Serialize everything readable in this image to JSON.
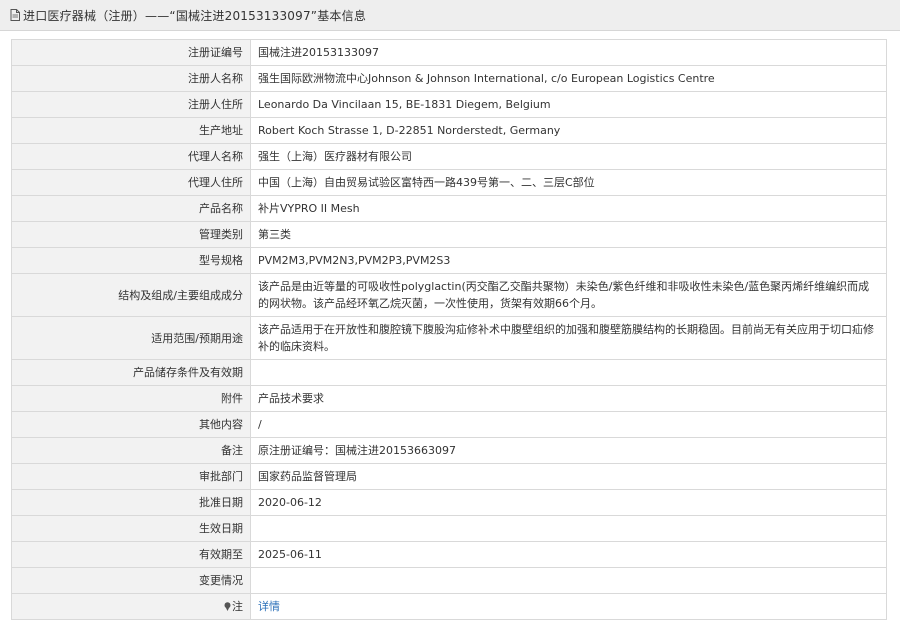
{
  "header": {
    "title": "进口医疗器械（注册）——“国械注进20153133097”基本信息"
  },
  "rows": [
    {
      "label": "注册证编号",
      "value": "国械注进20153133097"
    },
    {
      "label": "注册人名称",
      "value": "强生国际欧洲物流中心Johnson & Johnson International, c/o European Logistics Centre"
    },
    {
      "label": "注册人住所",
      "value": "Leonardo Da Vincilaan 15, BE-1831 Diegem, Belgium"
    },
    {
      "label": "生产地址",
      "value": "Robert Koch Strasse 1, D-22851 Norderstedt, Germany"
    },
    {
      "label": "代理人名称",
      "value": "强生（上海）医疗器材有限公司"
    },
    {
      "label": "代理人住所",
      "value": "中国（上海）自由贸易试验区富特西一路439号第一、二、三层C部位"
    },
    {
      "label": "产品名称",
      "value": "补片VYPRO II Mesh"
    },
    {
      "label": "管理类别",
      "value": "第三类"
    },
    {
      "label": "型号规格",
      "value": "PVM2M3,PVM2N3,PVM2P3,PVM2S3"
    },
    {
      "label": "结构及组成/主要组成成分",
      "value": "该产品是由近等量的可吸收性polyglactin(丙交酯乙交酯共聚物）未染色/紫色纤维和非吸收性未染色/蓝色聚丙烯纤维编织而成的网状物。该产品经环氧乙烷灭菌，一次性使用，货架有效期66个月。"
    },
    {
      "label": "适用范围/预期用途",
      "value": "该产品适用于在开放性和腹腔镜下腹股沟疝修补术中腹壁组织的加强和腹壁筋膜结构的长期稳固。目前尚无有关应用于切口疝修补的临床资料。"
    },
    {
      "label": "产品储存条件及有效期",
      "value": ""
    },
    {
      "label": "附件",
      "value": "产品技术要求"
    },
    {
      "label": "其他内容",
      "value": "/"
    },
    {
      "label": "备注",
      "value": "原注册证编号：国械注进20153663097"
    },
    {
      "label": "审批部门",
      "value": "国家药品监督管理局"
    },
    {
      "label": "批准日期",
      "value": "2020-06-12"
    },
    {
      "label": "生效日期",
      "value": ""
    },
    {
      "label": "有效期至",
      "value": "2025-06-11"
    },
    {
      "label": "变更情况",
      "value": ""
    }
  ],
  "note_row": {
    "label": "注",
    "icon": "pin-icon",
    "link_text": "详情",
    "link_color": "#2a6fb8"
  }
}
